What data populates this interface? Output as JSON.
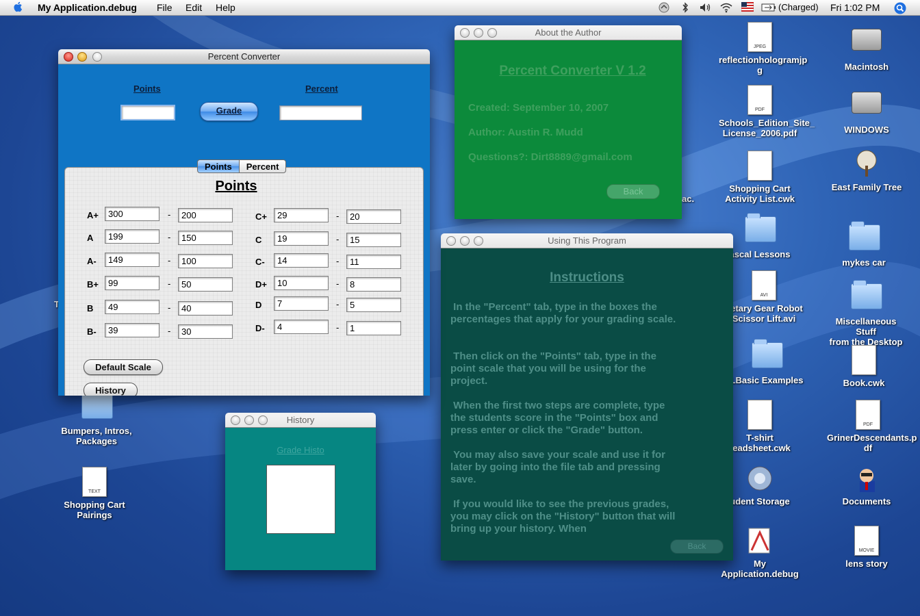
{
  "menubar": {
    "app_name": "My Application.debug",
    "menus": [
      "File",
      "Edit",
      "Help"
    ],
    "battery_status": "(Charged)",
    "clock": "Fri 1:02 PM"
  },
  "percent_converter": {
    "title": "Percent Converter",
    "points_label": "Points",
    "percent_label": "Percent",
    "points_value": "",
    "percent_value": "",
    "grade_button": "Grade",
    "tabs": [
      "Points",
      "Percent"
    ],
    "panel_title": "Points",
    "grades_left": [
      {
        "grade": "A+",
        "high": "300",
        "low": "200"
      },
      {
        "grade": "A",
        "high": "199",
        "low": "150"
      },
      {
        "grade": "A-",
        "high": "149",
        "low": "100"
      },
      {
        "grade": "B+",
        "high": "99",
        "low": "50"
      },
      {
        "grade": "B",
        "high": "49",
        "low": "40"
      },
      {
        "grade": "B-",
        "high": "39",
        "low": "30"
      }
    ],
    "grades_right": [
      {
        "grade": "C+",
        "high": "29",
        "low": "20"
      },
      {
        "grade": "C",
        "high": "19",
        "low": "15"
      },
      {
        "grade": "C-",
        "high": "14",
        "low": "11"
      },
      {
        "grade": "D+",
        "high": "10",
        "low": "8"
      },
      {
        "grade": "D",
        "high": "7",
        "low": "5"
      },
      {
        "grade": "D-",
        "high": "4",
        "low": "1"
      }
    ],
    "dash": "-",
    "default_scale_button": "Default Scale",
    "history_button": "History"
  },
  "about": {
    "title": "About the Author",
    "heading": "Percent Converter V 1.2",
    "created": "Created: September 10, 2007",
    "author": "Author: Austin R. Mudd",
    "questions": "Questions?: Dirt8889@gmail.com",
    "back_button": "Back"
  },
  "using": {
    "title": "Using This Program",
    "heading": "Instructions",
    "paragraphs": [
      " In the \"Percent\" tab, type in the boxes the percentages that apply for your grading scale.",
      " Then click on the \"Points\" tab, type in the point scale that you will be using for the project.",
      " When the first two steps are complete, type the students score in the \"Points\" box and press enter or click the \"Grade\" button.",
      " You may also save your scale and use it for later by going into the file tab and pressing save.",
      " If you would like to see the previous grades, you may click on the \"History\" button that will bring up your history. When"
    ],
    "back_button": "Back"
  },
  "history": {
    "title": "History",
    "link": "Grade Histo"
  },
  "desktop_icons": [
    {
      "name": "reflectionhologramjpg",
      "label": "reflectionhologramjp\ng",
      "tag": "JPEG"
    },
    {
      "name": "macintosh",
      "label": "Macintosh"
    },
    {
      "name": "schools-edition",
      "label": "Schools_Edition_Site_\nLicense_2006.pdf",
      "tag": "PDF"
    },
    {
      "name": "windows",
      "label": "WINDOWS"
    },
    {
      "name": "shopping-cart-activity",
      "label": "Shopping Cart\nActivity List.cwk"
    },
    {
      "name": "east-family-tree",
      "label": "East Family Tree"
    },
    {
      "name": "pascal-lessons",
      "label": "ascal Lessons"
    },
    {
      "name": "mykes-car",
      "label": "mykes car"
    },
    {
      "name": "gear-robot",
      "label": "netary Gear Robot\nScissor Lift.avi",
      "tag": "AVI"
    },
    {
      "name": "misc-stuff",
      "label": "Miscellaneous Stuff\nfrom the Desktop"
    },
    {
      "name": "lbasic",
      "label": "LBasic Examples"
    },
    {
      "name": "book",
      "label": "Book.cwk"
    },
    {
      "name": "tshirt",
      "label": "T-shirt\nreadsheet.cwk"
    },
    {
      "name": "griner",
      "label": "GrinerDescendants.p\ndf",
      "tag": "PDF"
    },
    {
      "name": "student-storage",
      "label": "udent Storage"
    },
    {
      "name": "documents",
      "label": "Documents"
    },
    {
      "name": "my-app",
      "label": "My Application.debug"
    },
    {
      "name": "lens-story",
      "label": "lens story",
      "tag": "MOVIE"
    },
    {
      "name": "bumpers",
      "label": "Bumpers, Intros,\nPackages"
    },
    {
      "name": "shopping-cart-pairings",
      "label": "Shopping Cart\nPairings",
      "tag": "TEXT"
    }
  ],
  "partial_desktop_text": {
    "ac": "ac.",
    "t": "T"
  },
  "colors": {
    "converter_bg": "#0f75c5",
    "about_bg": "#0c8a3b",
    "using_bg": "#0a4c45",
    "history_bg": "#068682"
  }
}
